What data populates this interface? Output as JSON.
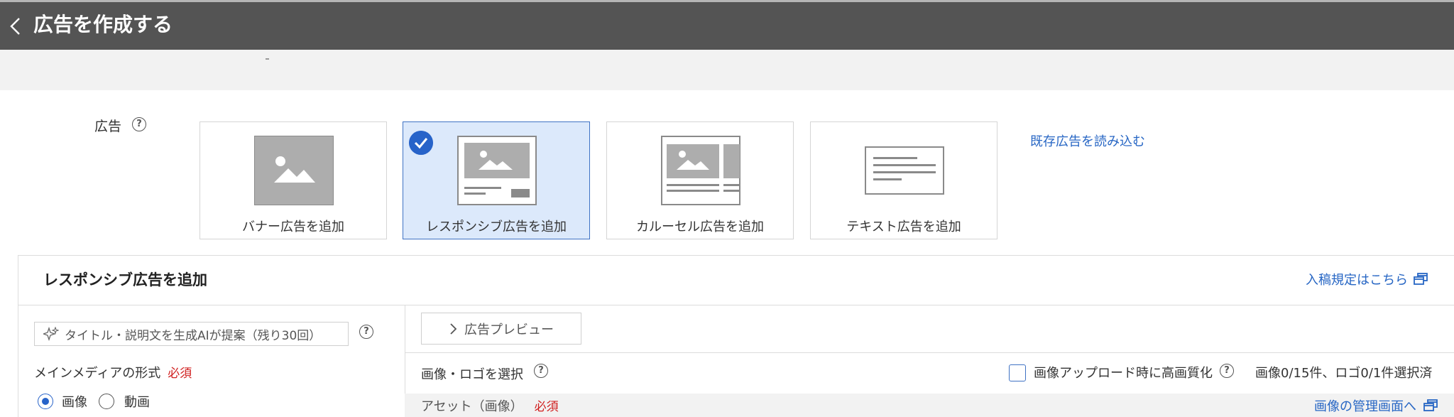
{
  "header": {
    "title": "広告を作成する"
  },
  "ad_section": {
    "label": "広告",
    "cards": [
      {
        "label": "バナー広告を追加",
        "selected": false
      },
      {
        "label": "レスポンシブ広告を追加",
        "selected": true
      },
      {
        "label": "カルーセル広告を追加",
        "selected": false
      },
      {
        "label": "テキスト広告を追加",
        "selected": false
      }
    ],
    "load_link": "既存広告を読み込む"
  },
  "panel": {
    "title": "レスポンシブ広告を追加",
    "rules_link": "入稿規定はこちら",
    "ai_button": "タイトル・説明文を生成AIが提案（残り30回）",
    "media_format": {
      "label": "メインメディアの形式",
      "required": "必須",
      "options": [
        "画像",
        "動画"
      ],
      "selected": "画像"
    },
    "preview_button": "広告プレビュー",
    "select_label": "画像・ロゴを選択",
    "hq_label": "画像アップロード時に高画質化",
    "count_text": "画像0/15件、ロゴ0/1件選択済",
    "asset_label": "アセット（画像）",
    "asset_required": "必須",
    "asset_link": "画像の管理画面へ"
  },
  "colors": {
    "header_bg": "#545454",
    "link": "#2766c4",
    "accent": "#2763c9",
    "required": "#d01f1f",
    "selected_bg": "#dce9fb"
  }
}
